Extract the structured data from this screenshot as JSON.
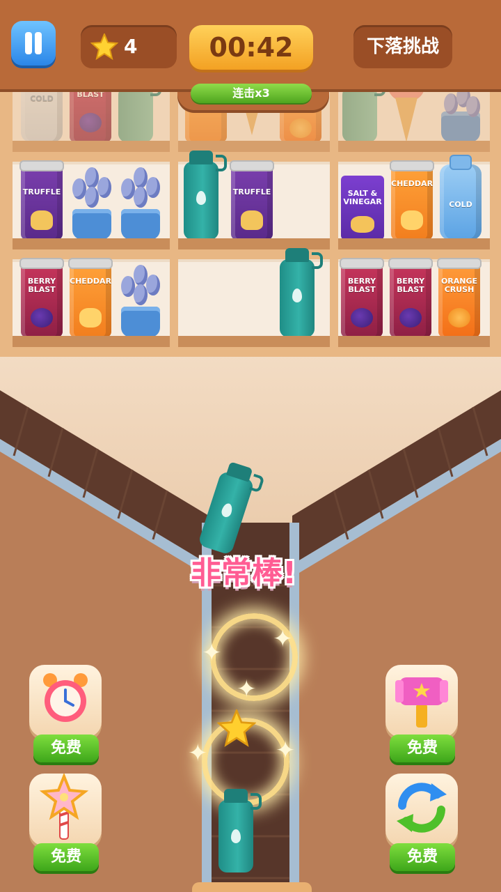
{
  "hud": {
    "star_count": "4",
    "timer": "00:42",
    "challenge_label": "下落挑战",
    "combo": "连击x3"
  },
  "shelf": {
    "row1": [
      "COLD",
      "BERRY BLAST",
      "",
      "",
      "",
      "",
      "",
      "",
      ""
    ],
    "labels": {
      "truffle": "TRUFFLE",
      "cheddar": "CHEDDAR",
      "cold": "COLD",
      "salt_vinegar": "SALT & VINEGAR",
      "berry": "BERRY BLAST",
      "orange": "ORANGE CRUSH"
    }
  },
  "feedback": {
    "praise": "非常棒!"
  },
  "powerups": {
    "free_label": "免费",
    "items": [
      {
        "icon": "alarm-clock-icon"
      },
      {
        "icon": "star-wand-icon"
      },
      {
        "icon": "hammer-icon"
      },
      {
        "icon": "shuffle-arrows-icon"
      }
    ]
  },
  "colors": {
    "hud_brown": "#b96a39",
    "timer_yellow": "#f3a123",
    "teal_bottle": "#2aa39a",
    "praise_pink": "#ff5c93",
    "green_button": "#4fa51f"
  }
}
